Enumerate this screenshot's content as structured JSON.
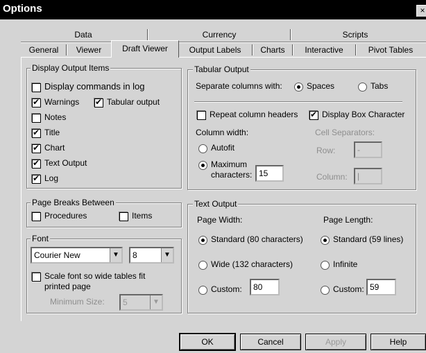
{
  "window": {
    "title": "Options",
    "close_glyph": "×"
  },
  "tabs": {
    "row1": [
      "Data",
      "Currency",
      "Scripts"
    ],
    "row2": [
      "General",
      "Viewer",
      "Draft Viewer",
      "Output Labels",
      "Charts",
      "Interactive",
      "Pivot Tables"
    ],
    "active": "Draft Viewer"
  },
  "display_output": {
    "title": "Display Output Items",
    "items": [
      {
        "label": "Display commands in log",
        "checked": false
      },
      {
        "label": "Warnings",
        "checked": true
      },
      {
        "label": "Tabular output",
        "checked": true
      },
      {
        "label": "Notes",
        "checked": false
      },
      {
        "label": "Title",
        "checked": true
      },
      {
        "label": "Chart",
        "checked": true
      },
      {
        "label": "Text Output",
        "checked": true
      },
      {
        "label": "Log",
        "checked": true
      }
    ]
  },
  "page_breaks": {
    "title": "Page Breaks Between",
    "procedures": {
      "label": "Procedures",
      "checked": false
    },
    "items": {
      "label": "Items",
      "checked": false
    }
  },
  "font": {
    "title": "Font",
    "family": "Courier New",
    "size": "8",
    "scale_label_1": "Scale font so wide tables fit",
    "scale_label_2": "printed page",
    "scale_checked": false,
    "min_size_label": "Minimum Size:",
    "min_size_value": "5"
  },
  "tabular_output": {
    "title": "Tabular Output",
    "separate_label": "Separate columns with:",
    "spaces_label": "Spaces",
    "tabs_label": "Tabs",
    "separator": "Spaces",
    "repeat_headers": {
      "label": "Repeat column headers",
      "checked": false
    },
    "display_box": {
      "label": "Display Box Character",
      "checked": true
    },
    "column_width_label": "Column width:",
    "autofit_label": "Autofit",
    "maximum_label": "Maximum",
    "characters_label": "characters:",
    "width_mode": "Maximum",
    "max_characters": "15",
    "cell_separators_label": "Cell Separators:",
    "row_label": "Row:",
    "row_value": "-",
    "column_label": "Column:",
    "column_value": "|"
  },
  "text_output": {
    "title": "Text Output",
    "page_width_label": "Page Width:",
    "page_length_label": "Page Length:",
    "width_standard": "Standard (80 characters)",
    "width_wide": "Wide (132 characters)",
    "width_custom": "Custom:",
    "width_custom_value": "80",
    "width_selected": "Standard",
    "length_standard": "Standard (59 lines)",
    "length_infinite": "Infinite",
    "length_custom": "Custom:",
    "length_custom_value": "59",
    "length_selected": "Standard"
  },
  "buttons": {
    "ok": "OK",
    "cancel": "Cancel",
    "apply": "Apply",
    "help": "Help"
  },
  "colors": {
    "face": "#d4d4d4",
    "titlebar": "#000000"
  }
}
